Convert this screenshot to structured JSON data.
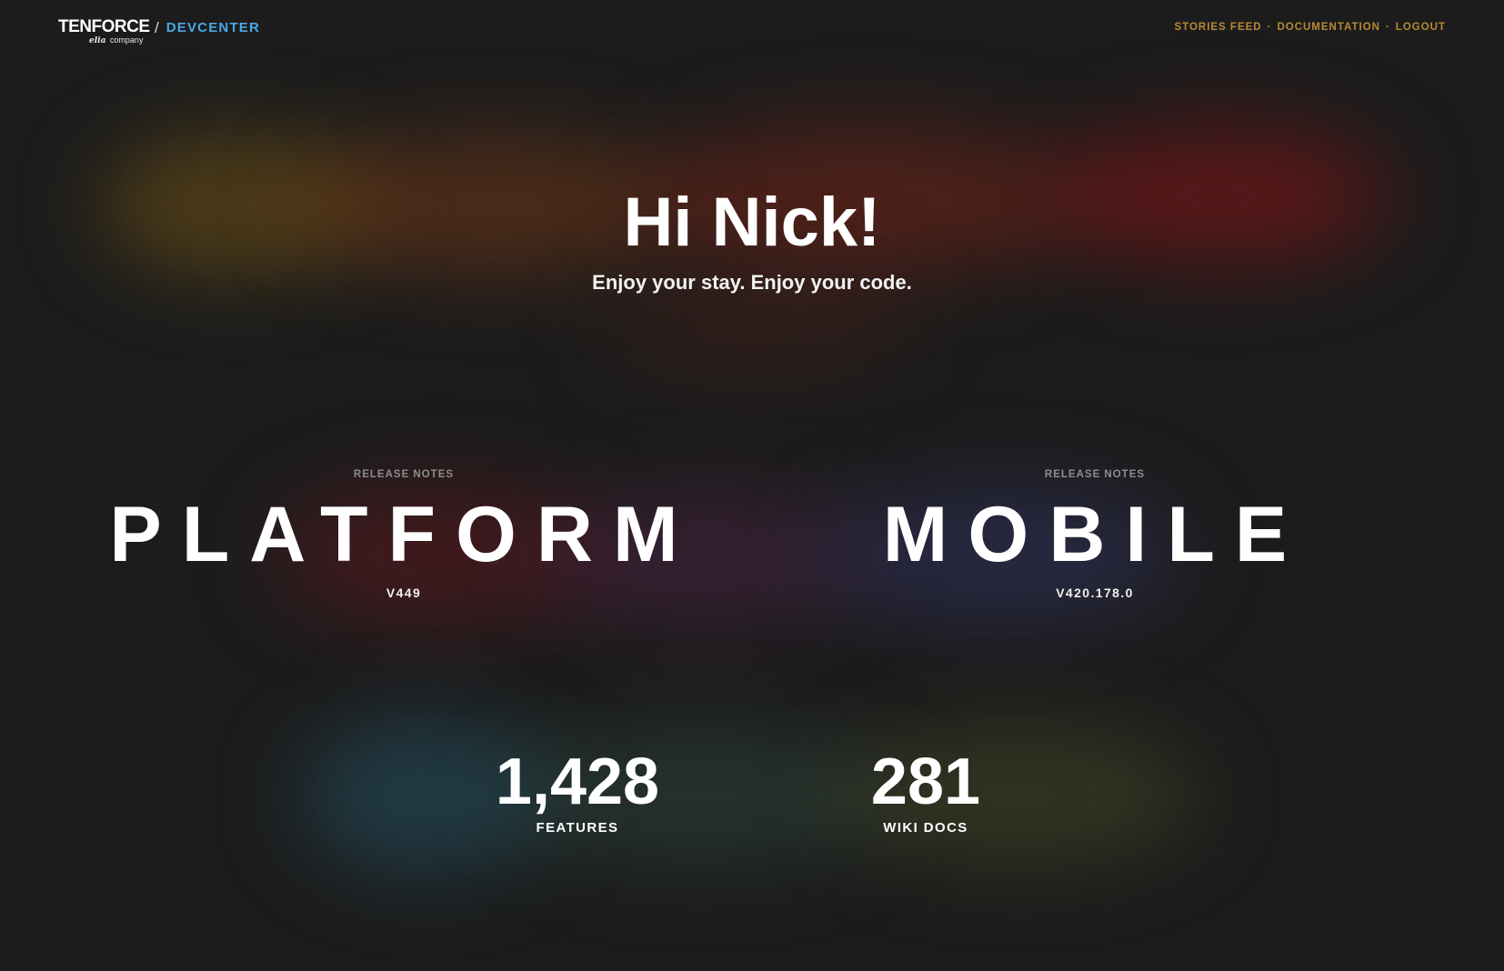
{
  "header": {
    "logo_text": "TENFORCE",
    "logo_sub_script": "elia",
    "logo_sub_text": "company",
    "separator": "/",
    "section": "DEVCENTER",
    "nav": [
      {
        "label": "STORIES FEED"
      },
      {
        "label": "DOCUMENTATION"
      },
      {
        "label": "LOGOUT"
      }
    ],
    "nav_separator": "·"
  },
  "greeting": {
    "title": "Hi Nick!",
    "subtitle": "Enjoy your stay. Enjoy your code."
  },
  "release_notes": [
    {
      "kicker": "RELEASE NOTES",
      "name": "PLATFORM",
      "version": "V449"
    },
    {
      "kicker": "RELEASE NOTES",
      "name": "MOBILE",
      "version": "V420.178.0"
    }
  ],
  "stats": [
    {
      "value": "1,428",
      "label": "FEATURES"
    },
    {
      "value": "281",
      "label": "WIKI DOCS"
    }
  ],
  "colors": {
    "background": "#1c1c1c",
    "accent_blue": "#4aa8e8",
    "nav_gold": "#b88936",
    "text": "#ffffff"
  }
}
